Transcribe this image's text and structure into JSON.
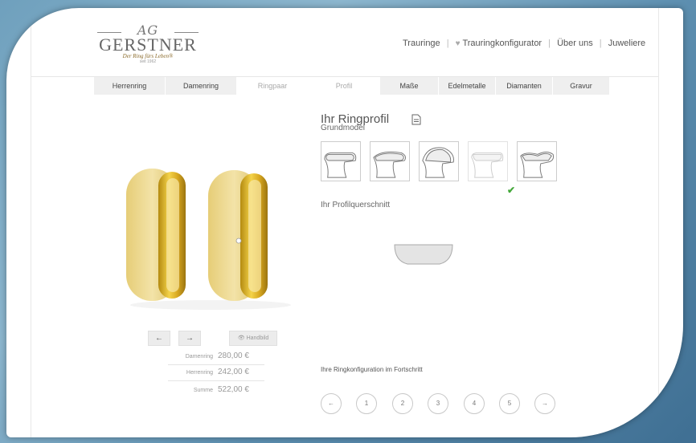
{
  "logo": {
    "monogram": "AG",
    "name": "GERSTNER",
    "tagline": "Der Ring fürs Leben®",
    "since": "seit 1962"
  },
  "topnav": {
    "items": [
      "Trauringe",
      "Trauringkonfigurator",
      "Über uns",
      "Juweliere"
    ]
  },
  "tabs": [
    {
      "label": "Herrenring",
      "active": true
    },
    {
      "label": "Damenring",
      "active": true
    },
    {
      "label": "Ringpaar",
      "active": false
    },
    {
      "label": "Profil",
      "active": false
    },
    {
      "label": "Maße",
      "active": true
    },
    {
      "label": "Edelmetalle",
      "active": true
    },
    {
      "label": "Diamanten",
      "active": true
    },
    {
      "label": "Gravur",
      "active": true
    }
  ],
  "main": {
    "title": "Ihr Ringprofil",
    "grundmodel_label": "Grundmodel",
    "selected_model_index": 4,
    "cross_section_label": "Ihr Profilquerschnitt"
  },
  "image_controls": {
    "prev": "←",
    "next": "→",
    "hand": "Handbild"
  },
  "prices": [
    {
      "label": "Damenring",
      "value": "280,00 €"
    },
    {
      "label": "Herrenring",
      "value": "242,00 €"
    },
    {
      "label": "Summe",
      "value": "522,00 €"
    }
  ],
  "progress": {
    "label": "Ihre Ringkonfiguration im Fortschritt",
    "prev": "←",
    "steps": [
      "1",
      "2",
      "3",
      "4",
      "5"
    ],
    "next": "→"
  },
  "colors": {
    "gold": "#d9b84a",
    "gold_light": "#efdb9a",
    "check": "#44a83a"
  }
}
